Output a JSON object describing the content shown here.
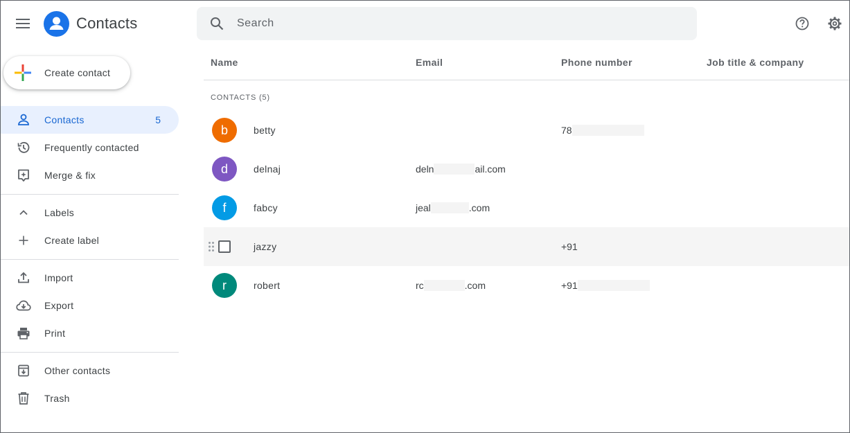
{
  "app": {
    "title": "Contacts"
  },
  "search": {
    "placeholder": "Search"
  },
  "create_contact": {
    "label": "Create contact"
  },
  "sidebar": {
    "contacts": {
      "label": "Contacts",
      "count": "5"
    },
    "frequently": {
      "label": "Frequently contacted"
    },
    "merge": {
      "label": "Merge & fix"
    },
    "labels": {
      "label": "Labels"
    },
    "create_label": {
      "label": "Create label"
    },
    "import": {
      "label": "Import"
    },
    "export": {
      "label": "Export"
    },
    "print": {
      "label": "Print"
    },
    "other": {
      "label": "Other contacts"
    },
    "trash": {
      "label": "Trash"
    }
  },
  "table": {
    "headers": {
      "name": "Name",
      "email": "Email",
      "phone": "Phone number",
      "job": "Job title & company"
    },
    "section_label": "CONTACTS (5)",
    "rows": [
      {
        "initial": "b",
        "name": "betty",
        "email_start": "",
        "email_end": "",
        "phone": "78",
        "avatar_color": "#ef6c00"
      },
      {
        "initial": "d",
        "name": "delnaj",
        "email_start": "deln",
        "email_end": "ail.com",
        "phone": "",
        "avatar_color": "#7e57c2"
      },
      {
        "initial": "f",
        "name": "fabcy",
        "email_start": "jeal",
        "email_end": ".com",
        "phone": "",
        "avatar_color": "#039be5"
      },
      {
        "initial": "",
        "name": "jazzy",
        "email_start": "",
        "email_end": "",
        "phone": "+91",
        "avatar_color": ""
      },
      {
        "initial": "r",
        "name": "robert",
        "email_start": "rc",
        "email_end": ".com",
        "phone": "+91",
        "avatar_color": "#00897b"
      }
    ]
  },
  "colors": {
    "accent": "#1967d2",
    "active_bg": "#e8f0fe",
    "logo_blue": "#1a73e8"
  }
}
